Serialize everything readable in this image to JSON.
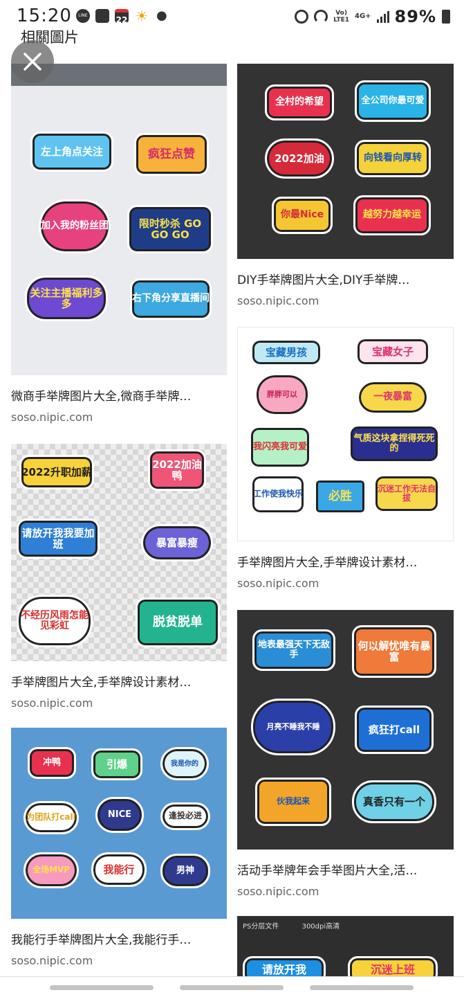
{
  "status": {
    "time": "15:20",
    "line_label": "LINE",
    "calendar_day": "22",
    "volte": "Vo)",
    "lte": "LTE1",
    "network": "4G+",
    "battery": "89%"
  },
  "header": {
    "title": "相關圖片"
  },
  "results": [
    {
      "title": "微商手举牌图片大全,微商手举牌…",
      "source": "soso.nipic.com",
      "signs": [
        "左上角点关注",
        "疯狂点赞",
        "加入我的粉丝团",
        "限时秒杀 GO GO GO",
        "关注主播福利多多",
        "右下角分享直播间"
      ]
    },
    {
      "title": "DIY手举牌图片大全,DIY手举牌…",
      "source": "soso.nipic.com",
      "signs": [
        "全村的希望",
        "全公司你最可爱",
        "2022加油",
        "向钱看向厚转",
        "你最Nice",
        "越努力越幸运"
      ]
    },
    {
      "title": "手举牌图片大全,手举牌设计素材…",
      "source": "soso.nipic.com",
      "signs": [
        "2022升职加薪",
        "2022加油鸭",
        "请放开我我要加班",
        "暴富暴瘦",
        "不经历风雨怎能见彩虹",
        "脱贫脱单"
      ]
    },
    {
      "title": "手举牌图片大全,手举牌设计素材…",
      "source": "soso.nipic.com",
      "signs": [
        "宝藏男孩",
        "宝藏女子",
        "胖胖可以",
        "一夜暴富",
        "我闪亮我可爱",
        "气质这块拿捏得死死的",
        "工作使我快乐",
        "必胜",
        "沉迷工作无法自拔"
      ]
    },
    {
      "title": "我能行手举牌图片大全,我能行手…",
      "source": "soso.nipic.com",
      "signs": [
        "冲鸭",
        "引爆",
        "我是你的",
        "为团队打call",
        "NICE",
        "逢投必进",
        "全场MVP",
        "我能行",
        "男神"
      ]
    },
    {
      "title": "活动手举牌年会手举图片大全,活…",
      "source": "soso.nipic.com",
      "signs": [
        "地表最强天下无敌手",
        "何以解忧唯有暴富",
        "月亮不睡我不睡",
        "疯狂打call",
        "伙我起来",
        "真香只有一个"
      ]
    },
    {
      "title": "",
      "source": "",
      "ps_label": "PS分层文件",
      "dpi_label": "300dpi高清",
      "signs": [
        "请放开我",
        "沉迷上班"
      ]
    }
  ],
  "colors": {
    "accent_blue": "#5a9ad3",
    "dark_thumb": "#333333",
    "text_primary": "#202124",
    "text_secondary": "#5f6368"
  }
}
